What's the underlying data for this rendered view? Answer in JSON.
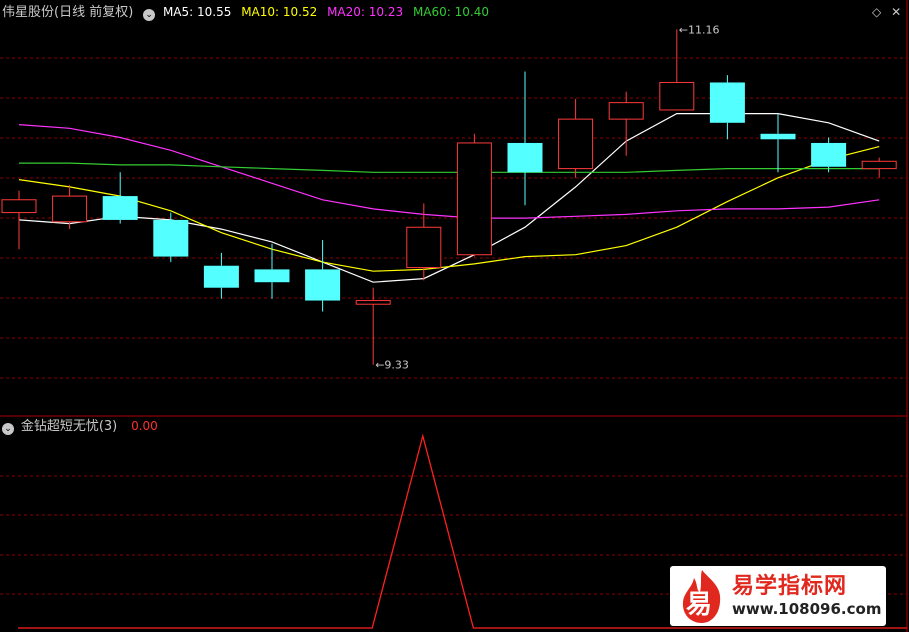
{
  "header": {
    "stock_title": "伟星股份(日线 前复权)",
    "ma5_label": "MA5: 10.55",
    "ma10_label": "MA10: 10.52",
    "ma20_label": "MA20: 10.23",
    "ma60_label": "MA60: 10.40"
  },
  "indicator": {
    "title": "金钻超短无忧(3)",
    "value": "0.00"
  },
  "watermark": {
    "logo_char": "易",
    "site_name": "易学指标网",
    "site_url": "www.108096.com"
  },
  "colors": {
    "up": "#ff3a3a",
    "down": "#54ffff",
    "ma5": "#ffffff",
    "ma10": "#ffff00",
    "ma20": "#ff33ff",
    "ma60": "#33cc33",
    "grid": "#8b0000",
    "indicator_line": "#ff2020"
  },
  "chart_data": [
    {
      "type": "candlestick",
      "ylim": [
        9.05,
        11.2
      ],
      "annotations": [
        {
          "label": "11.16",
          "candle": 13,
          "value": 11.16
        },
        {
          "label": "9.33",
          "candle": 7,
          "value": 9.33
        }
      ],
      "candles": [
        {
          "open": 10.16,
          "high": 10.28,
          "low": 9.96,
          "close": 10.23
        },
        {
          "open": 10.11,
          "high": 10.31,
          "low": 10.07,
          "close": 10.25
        },
        {
          "open": 10.25,
          "high": 10.38,
          "low": 10.1,
          "close": 10.12
        },
        {
          "open": 10.12,
          "high": 10.16,
          "low": 9.89,
          "close": 9.92
        },
        {
          "open": 9.87,
          "high": 9.94,
          "low": 9.69,
          "close": 9.75
        },
        {
          "open": 9.85,
          "high": 9.99,
          "low": 9.69,
          "close": 9.78
        },
        {
          "open": 9.85,
          "high": 10.01,
          "low": 9.62,
          "close": 9.68
        },
        {
          "open": 9.66,
          "high": 9.75,
          "low": 9.33,
          "close": 9.68
        },
        {
          "open": 9.86,
          "high": 10.21,
          "low": 9.79,
          "close": 10.08
        },
        {
          "open": 9.93,
          "high": 10.59,
          "low": 9.92,
          "close": 10.54
        },
        {
          "open": 10.54,
          "high": 10.93,
          "low": 10.2,
          "close": 10.38
        },
        {
          "open": 10.4,
          "high": 10.78,
          "low": 10.35,
          "close": 10.67
        },
        {
          "open": 10.67,
          "high": 10.82,
          "low": 10.47,
          "close": 10.76
        },
        {
          "open": 10.72,
          "high": 11.16,
          "low": 10.72,
          "close": 10.87
        },
        {
          "open": 10.87,
          "high": 10.91,
          "low": 10.56,
          "close": 10.65
        },
        {
          "open": 10.59,
          "high": 10.7,
          "low": 10.38,
          "close": 10.56
        },
        {
          "open": 10.54,
          "high": 10.57,
          "low": 10.38,
          "close": 10.41
        },
        {
          "open": 10.4,
          "high": 10.46,
          "low": 10.35,
          "close": 10.44
        }
      ],
      "ma_series": [
        {
          "name": "MA5",
          "color": "#ffffff",
          "values": [
            10.12,
            10.1,
            10.14,
            10.12,
            10.07,
            10.0,
            9.89,
            9.78,
            9.8,
            9.93,
            10.08,
            10.3,
            10.55,
            10.7,
            10.7,
            10.7,
            10.65,
            10.55
          ]
        },
        {
          "name": "MA10",
          "color": "#ffff00",
          "values": [
            10.34,
            10.3,
            10.25,
            10.17,
            10.05,
            9.96,
            9.89,
            9.84,
            9.85,
            9.88,
            9.92,
            9.93,
            9.98,
            10.08,
            10.22,
            10.35,
            10.45,
            10.52
          ]
        },
        {
          "name": "MA20",
          "color": "#ff33ff",
          "values": [
            10.64,
            10.62,
            10.57,
            10.5,
            10.41,
            10.32,
            10.23,
            10.18,
            10.15,
            10.13,
            10.13,
            10.14,
            10.15,
            10.17,
            10.18,
            10.18,
            10.19,
            10.23
          ]
        },
        {
          "name": "MA60",
          "color": "#33cc33",
          "values": [
            10.43,
            10.43,
            10.42,
            10.42,
            10.41,
            10.4,
            10.39,
            10.38,
            10.38,
            10.38,
            10.38,
            10.38,
            10.38,
            10.39,
            10.4,
            10.4,
            10.4,
            10.4
          ]
        }
      ]
    },
    {
      "type": "line",
      "ylim": [
        0,
        100
      ],
      "series": [
        {
          "values": [
            0,
            0,
            0,
            0,
            0,
            0,
            0,
            0,
            100,
            0,
            0,
            0,
            0,
            0,
            0,
            0,
            0,
            0
          ]
        }
      ]
    }
  ]
}
